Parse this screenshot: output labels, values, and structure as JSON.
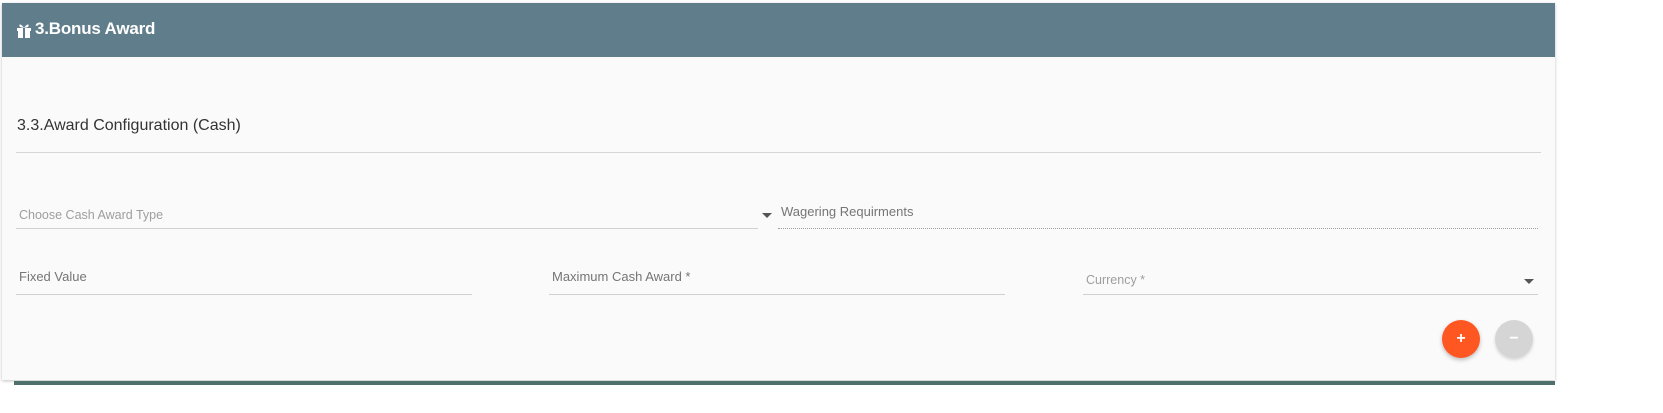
{
  "header": {
    "icon": "gift-icon",
    "title": "3.Bonus Award",
    "background_color": "#607d8b"
  },
  "section": {
    "title": "3.3.Award Configuration (Cash)"
  },
  "fields": {
    "cash_award_type": {
      "placeholder": "Choose Cash Award Type",
      "icon": "chevron-down-icon"
    },
    "wagering_requirements": {
      "label": "Wagering Requirments"
    },
    "fixed_value": {
      "label": "Fixed Value"
    },
    "maximum_cash_award": {
      "label": "Maximum Cash Award *"
    },
    "currency": {
      "placeholder": "Currency *",
      "icon": "chevron-down-icon"
    }
  },
  "actions": {
    "add_label": "+",
    "remove_label": "−",
    "add_color": "#ff5722",
    "remove_color": "#d5d5d5"
  }
}
